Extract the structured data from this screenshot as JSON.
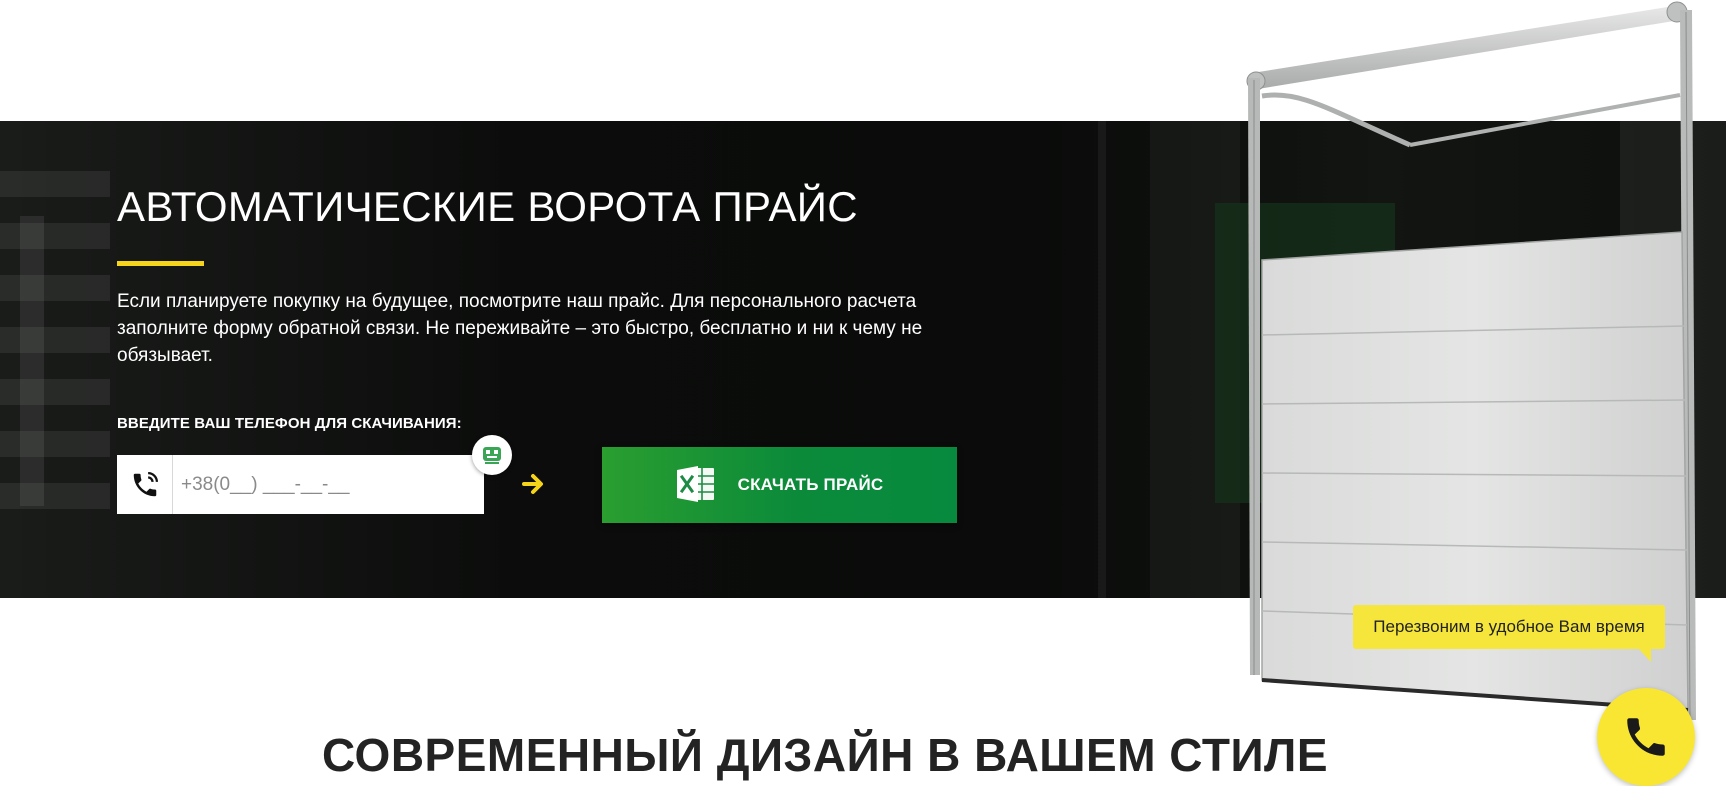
{
  "hero": {
    "title": "АВТОМАТИЧЕСКИЕ ВОРОТА ПРАЙС",
    "description": "Если планируете покупку на будущее, посмотрите наш прайс. Для персонального расчета заполните форму обратной связи. Не переживайте – это быстро, бесплатно и ни к чему не обязывает.",
    "phone_label": "ВВЕДИТЕ ВАШ ТЕЛЕФОН ДЛЯ СКАЧИВАНИЯ:",
    "phone_placeholder": "+38(0__) ___-__-__",
    "download_button_label": "СКАЧАТЬ ПРАЙС",
    "accent_color": "#f6d41b",
    "button_color": "#078a3e"
  },
  "callback": {
    "tooltip": "Перезвоним в удобное Вам время",
    "color": "#f9e633"
  },
  "section": {
    "heading": "СОВРЕМЕННЫЙ ДИЗАЙН В ВАШЕМ СТИЛЕ"
  },
  "icons": {
    "phone_field": "phone-handset-icon",
    "autofill": "autofill-icon",
    "arrow": "arrow-right-icon",
    "excel": "excel-icon",
    "call": "phone-icon"
  }
}
